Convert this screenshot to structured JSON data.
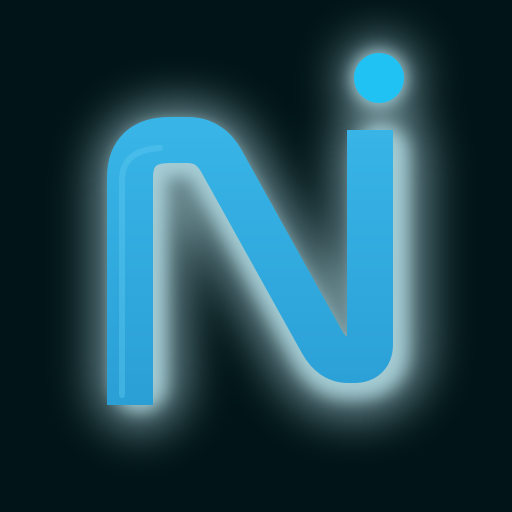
{
  "icon": {
    "semantic": "neon-ni-logo-icon",
    "colors": {
      "background": "#011518",
      "glow": "#bfe9f2",
      "stroke": "#2fa8e0",
      "dot": "#1fc2f2"
    }
  }
}
